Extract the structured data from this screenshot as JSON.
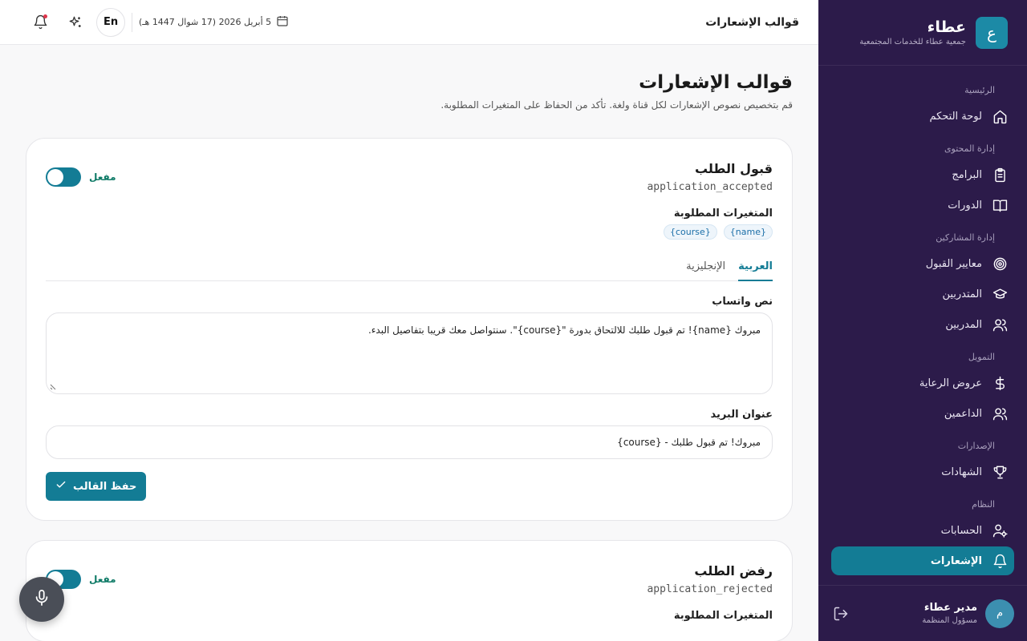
{
  "brand": {
    "name": "عطاء",
    "subtitle": "جمعية عطاء للخدمات المجتمعية",
    "logo_letter": "ع"
  },
  "sidebar": {
    "sections": [
      {
        "label": "الرئيسية",
        "items": [
          {
            "label": "لوحة التحكم",
            "icon": "home-icon"
          }
        ]
      },
      {
        "label": "إدارة المحتوى",
        "items": [
          {
            "label": "البرامج",
            "icon": "clipboard-icon"
          },
          {
            "label": "الدورات",
            "icon": "book-icon"
          }
        ]
      },
      {
        "label": "إدارة المشاركين",
        "items": [
          {
            "label": "معايير القبول",
            "icon": "target-icon"
          },
          {
            "label": "المتدربين",
            "icon": "graduation-cap-icon"
          },
          {
            "label": "المدربين",
            "icon": "users-icon"
          }
        ]
      },
      {
        "label": "التمويل",
        "items": [
          {
            "label": "عروض الرعاية",
            "icon": "dollar-icon"
          },
          {
            "label": "الداعمين",
            "icon": "users-icon"
          }
        ]
      },
      {
        "label": "الإصدارات",
        "items": [
          {
            "label": "الشهادات",
            "icon": "trophy-icon"
          }
        ]
      },
      {
        "label": "النظام",
        "items": [
          {
            "label": "الحسابات",
            "icon": "user-cog-icon"
          },
          {
            "label": "الإشعارات",
            "icon": "bell-icon",
            "active": true
          }
        ]
      }
    ],
    "user": {
      "name": "مدير عطاء",
      "role": "مسؤول المنظمة",
      "initial": "م"
    }
  },
  "header": {
    "title": "قوالب الإشعارات",
    "date": "5 أبريل 2026 (17 شوال 1447 هـ)",
    "lang_button": "En"
  },
  "page": {
    "title": "قوالب الإشعارات",
    "subtitle": "قم بتخصيص نصوص الإشعارات لكل قناة ولغة. تأكد من الحفاظ على المتغيرات المطلوبة."
  },
  "templates": [
    {
      "title": "قبول الطلب",
      "key": "application_accepted",
      "toggle_label": "مفعل",
      "enabled": true,
      "vars_title": "المتغيرات المطلوبة",
      "vars": [
        "{name}",
        "{course}"
      ],
      "tabs": [
        "العربية",
        "الإنجليزية"
      ],
      "whatsapp_label": "نص واتساب",
      "whatsapp_text": "مبروك {name}! تم قبول طلبك للالتحاق بدورة \"{course}\". سنتواصل معك قريبا بتفاصيل البدء.",
      "email_label": "عنوان البريد",
      "email_subject": "مبروك! تم قبول طلبك - {course}",
      "save_label": "حفظ القالب"
    },
    {
      "title": "رفض الطلب",
      "key": "application_rejected",
      "toggle_label": "مفعل",
      "enabled": true,
      "vars_title": "المتغيرات المطلوبة"
    }
  ],
  "colors": {
    "sidebar_bg": "#2c1b4a",
    "accent": "#137c95",
    "active_text": "#0d7a66"
  }
}
